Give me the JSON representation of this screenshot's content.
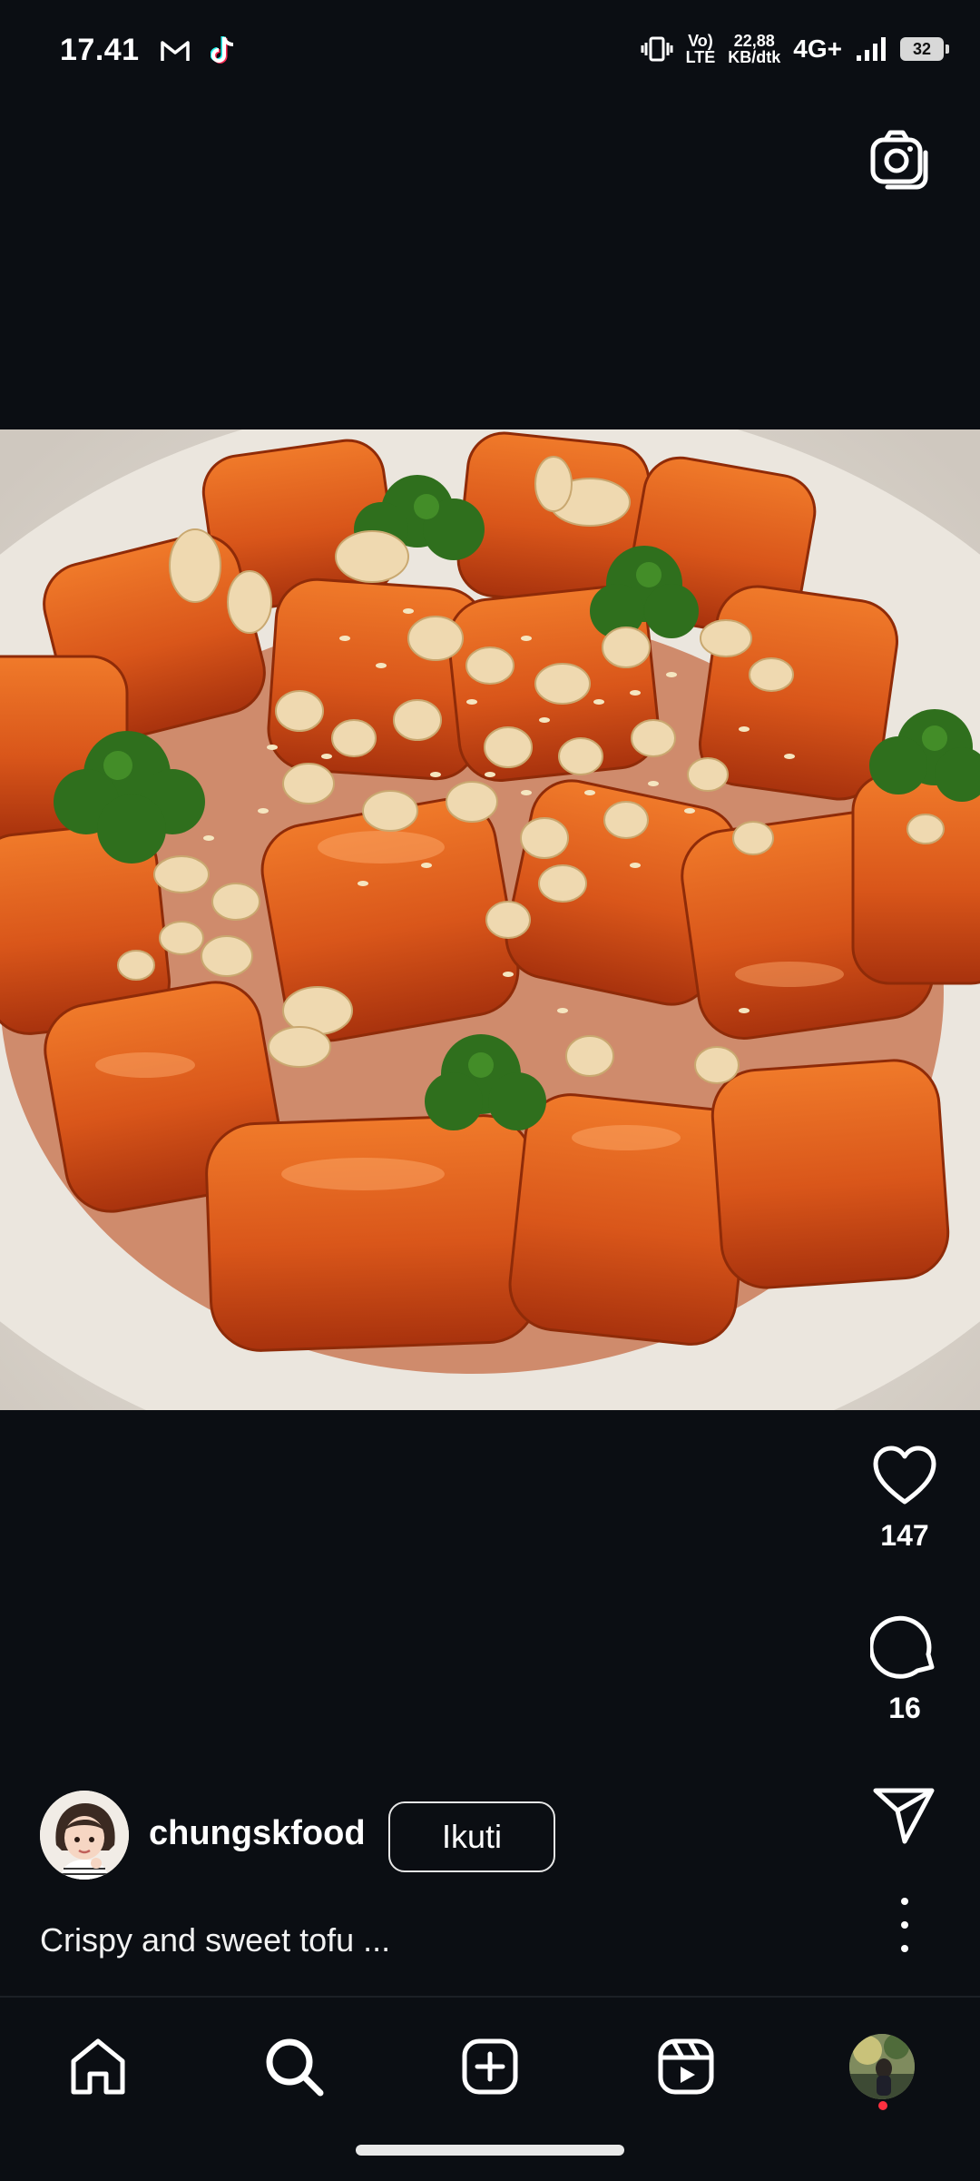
{
  "status_bar": {
    "time": "17.41",
    "net_top": "Vo)",
    "net_bottom": "LTE",
    "speed_top": "22,88",
    "speed_bottom": "KB/dtk",
    "network": "4G+",
    "battery": "32"
  },
  "post": {
    "likes": "147",
    "comments": "16",
    "author": {
      "username": "chungskfood",
      "follow_label": "Ikuti"
    },
    "caption": "Crispy and sweet tofu ..."
  },
  "icons": {
    "camera": "camera-icon",
    "like": "heart-icon",
    "comment": "comment-icon",
    "share": "send-icon",
    "more": "more-vertical-icon",
    "home": "home-icon",
    "search": "search-icon",
    "create": "add-icon",
    "reels": "reels-icon"
  },
  "colors": {
    "background": "#0b0e13",
    "notification_dot": "#ff3040",
    "sauce": "#d85a16"
  }
}
